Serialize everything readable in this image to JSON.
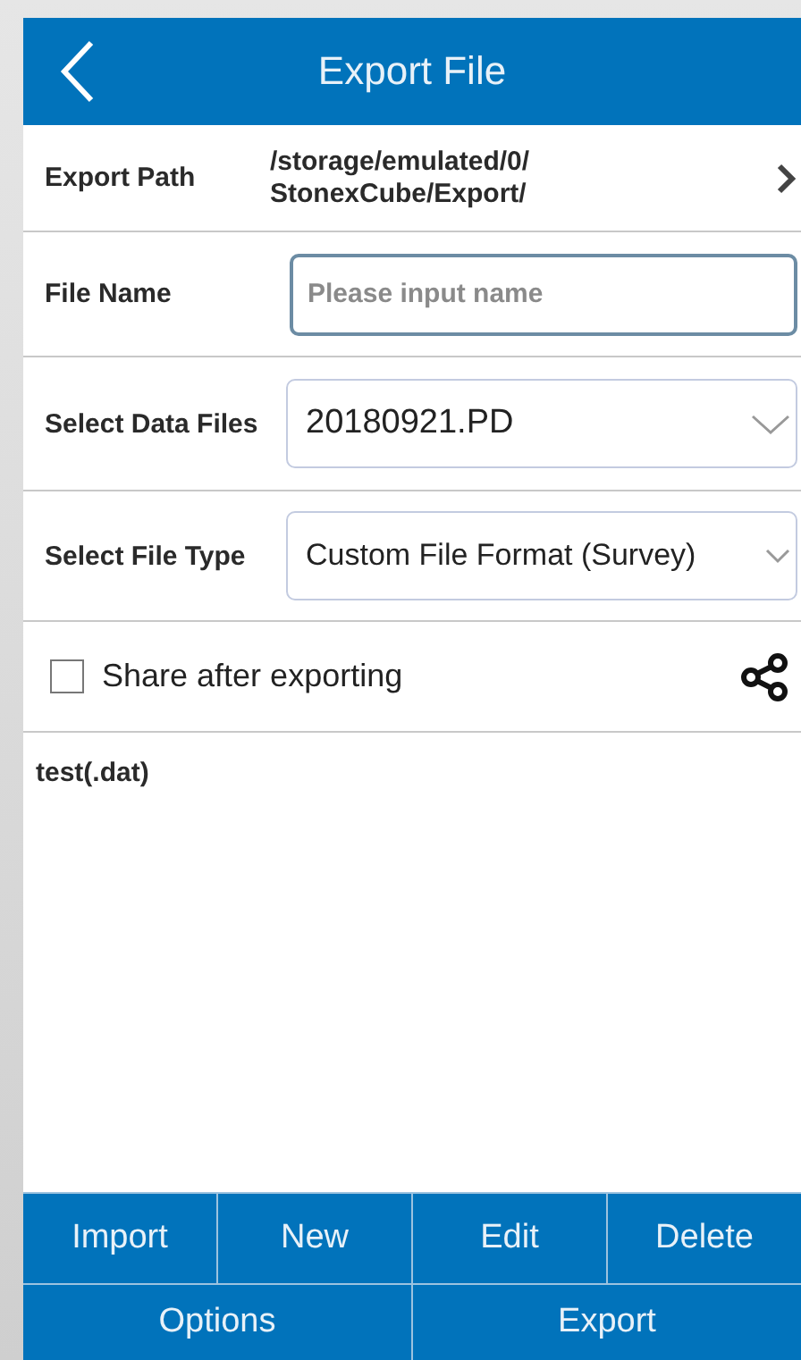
{
  "header": {
    "title": "Export File"
  },
  "export_path": {
    "label": "Export Path",
    "value": "/storage/emulated/0/\nStonexCube/Export/"
  },
  "file_name": {
    "label": "File Name",
    "placeholder": "Please input name"
  },
  "data_files": {
    "label": "Select Data Files",
    "value": "20180921.PD"
  },
  "file_type": {
    "label": "Select File Type",
    "value": "Custom File Format (Survey)"
  },
  "share": {
    "label": "Share after exporting",
    "checked": false
  },
  "formats": [
    {
      "label": "test(.dat)",
      "selected": false
    }
  ],
  "buttons_row_1": [
    "Import",
    "New",
    "Edit",
    "Delete"
  ],
  "buttons_row_2": [
    "Options",
    "Export"
  ]
}
